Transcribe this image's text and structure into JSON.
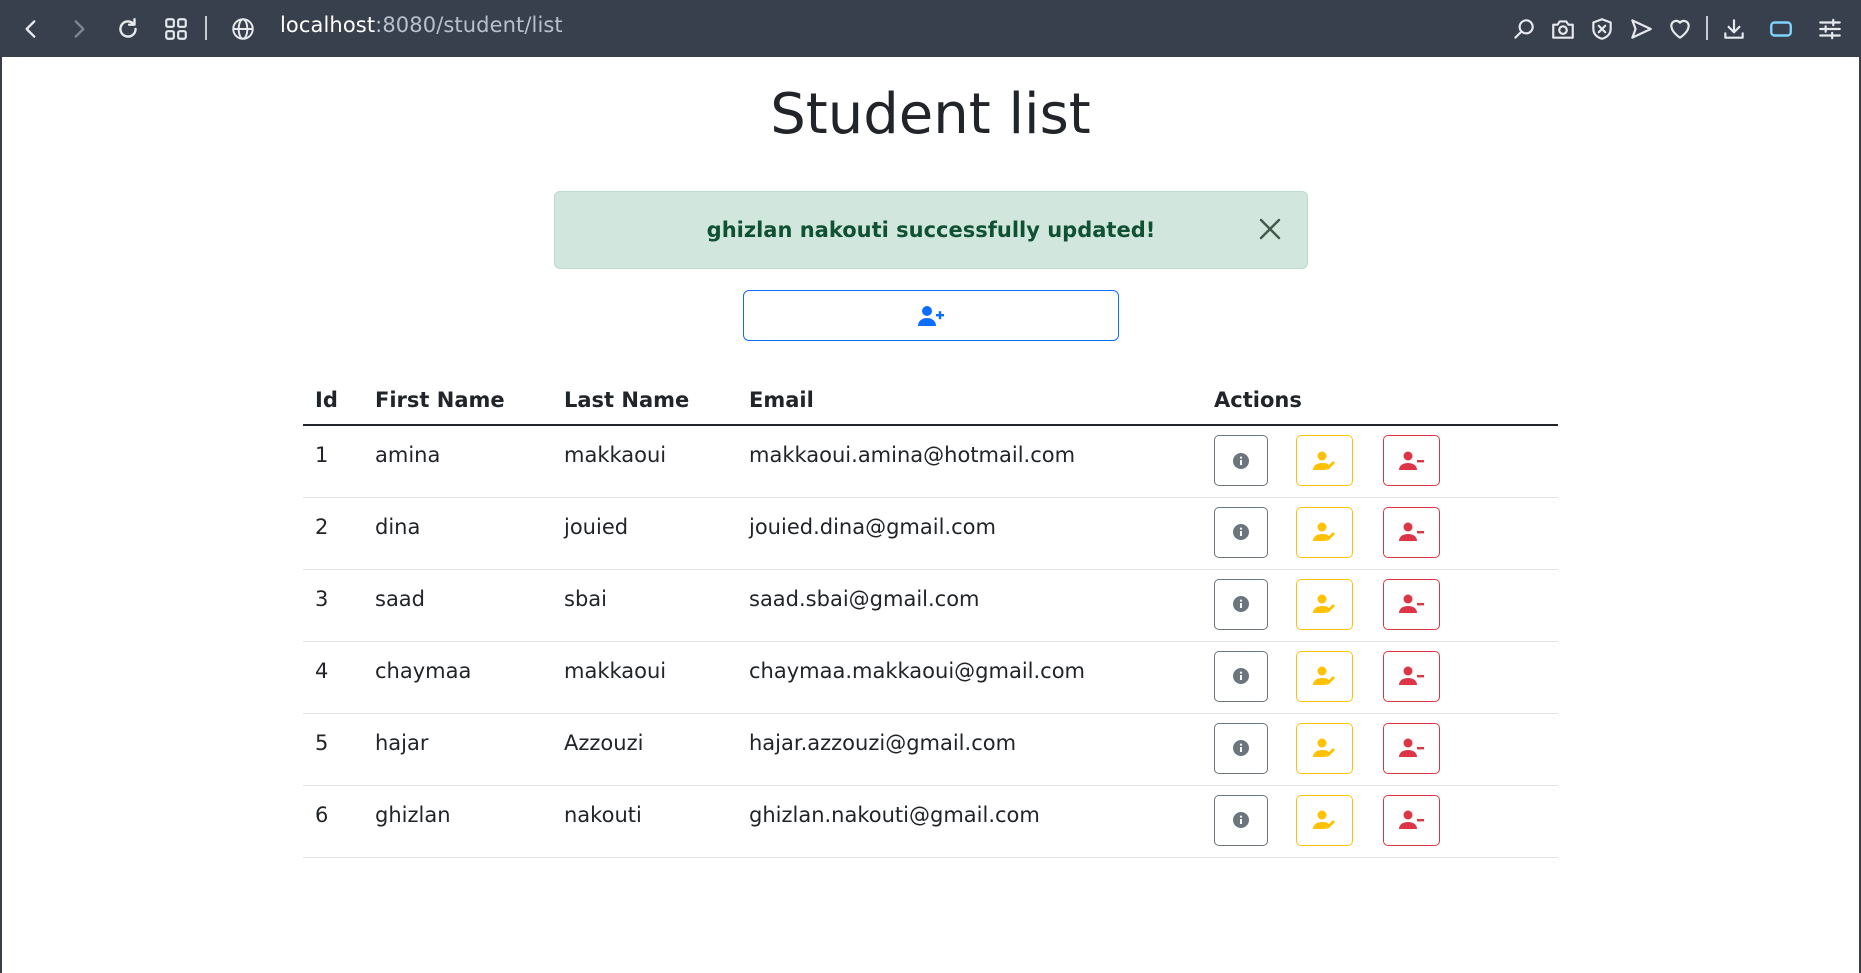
{
  "browser": {
    "url_host": "localhost",
    "url_path": ":8080/student/list"
  },
  "page": {
    "title": "Student list"
  },
  "alert": {
    "message": "ghizlan nakouti successfully updated!"
  },
  "table": {
    "headers": [
      "Id",
      "First Name",
      "Last Name",
      "Email",
      "Actions"
    ],
    "rows": [
      {
        "id": "1",
        "first": "amina",
        "last": "makkaoui",
        "email": "makkaoui.amina@hotmail.com"
      },
      {
        "id": "2",
        "first": "dina",
        "last": "jouied",
        "email": "jouied.dina@gmail.com"
      },
      {
        "id": "3",
        "first": "saad",
        "last": "sbai",
        "email": "saad.sbai@gmail.com"
      },
      {
        "id": "4",
        "first": "chaymaa",
        "last": "makkaoui",
        "email": "chaymaa.makkaoui@gmail.com"
      },
      {
        "id": "5",
        "first": "hajar",
        "last": "Azzouzi",
        "email": "hajar.azzouzi@gmail.com"
      },
      {
        "id": "6",
        "first": "ghizlan",
        "last": "nakouti",
        "email": "ghizlan.nakouti@gmail.com"
      }
    ]
  },
  "colors": {
    "chrome": "#37404c",
    "alert_bg": "#d1e7dd",
    "alert_text": "#0f5132",
    "primary": "#0d6efd",
    "warning": "#ffc107",
    "danger": "#dc3545",
    "secondary": "#6c757d"
  },
  "icons": {
    "add": "user-plus-icon",
    "info": "info-circle-icon",
    "edit": "user-pen-icon",
    "delete": "user-minus-icon",
    "close": "close-icon"
  }
}
